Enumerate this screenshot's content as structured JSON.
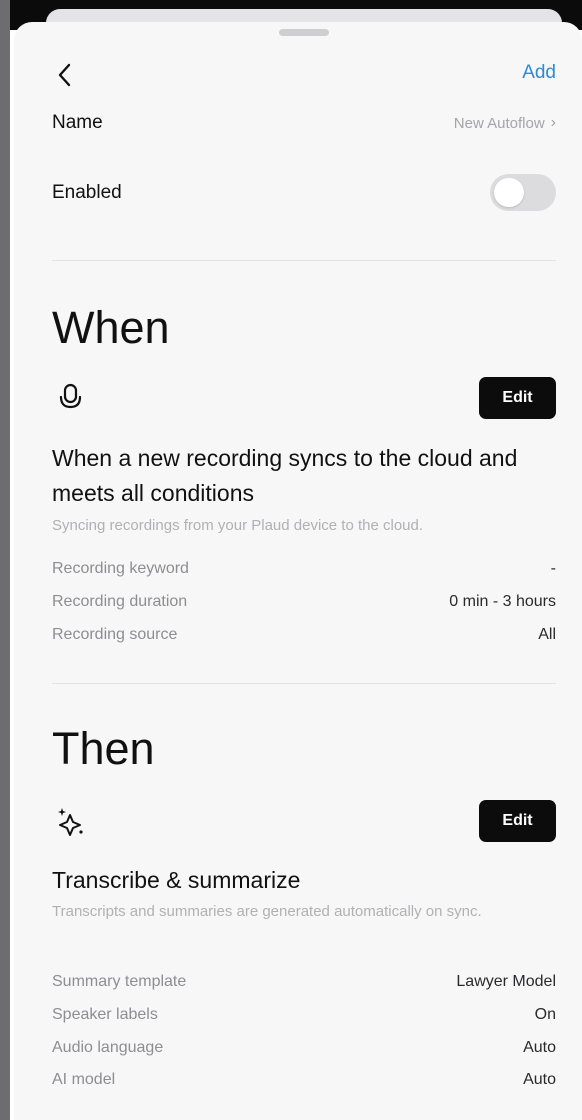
{
  "header": {
    "action_label": "Add"
  },
  "name_row": {
    "label": "Name",
    "value": "New Autoflow",
    "chevron": "›"
  },
  "enabled_row": {
    "label": "Enabled",
    "toggled": false
  },
  "when": {
    "title": "When",
    "icon": "microphone-icon",
    "edit_label": "Edit",
    "heading": "When a new recording syncs to the cloud and meets all conditions",
    "description": "Syncing recordings from your Plaud device to the cloud.",
    "conditions": [
      {
        "label": "Recording keyword",
        "value": "-"
      },
      {
        "label": "Recording duration",
        "value": "0 min - 3 hours"
      },
      {
        "label": "Recording source",
        "value": "All"
      }
    ]
  },
  "then": {
    "title": "Then",
    "icon": "sparkle-icon",
    "edit_label": "Edit",
    "heading": "Transcribe & summarize",
    "description": "Transcripts and summaries are generated automatically on sync.",
    "settings": [
      {
        "label": "Summary template",
        "value": "Lawyer Model"
      },
      {
        "label": "Speaker labels",
        "value": "On"
      },
      {
        "label": "Audio language",
        "value": "Auto"
      },
      {
        "label": "AI model",
        "value": "Auto"
      }
    ]
  },
  "colors": {
    "accent": "#2c8bd6",
    "button_bg": "#0c0c0c",
    "sheet_bg": "#f7f7f7"
  }
}
